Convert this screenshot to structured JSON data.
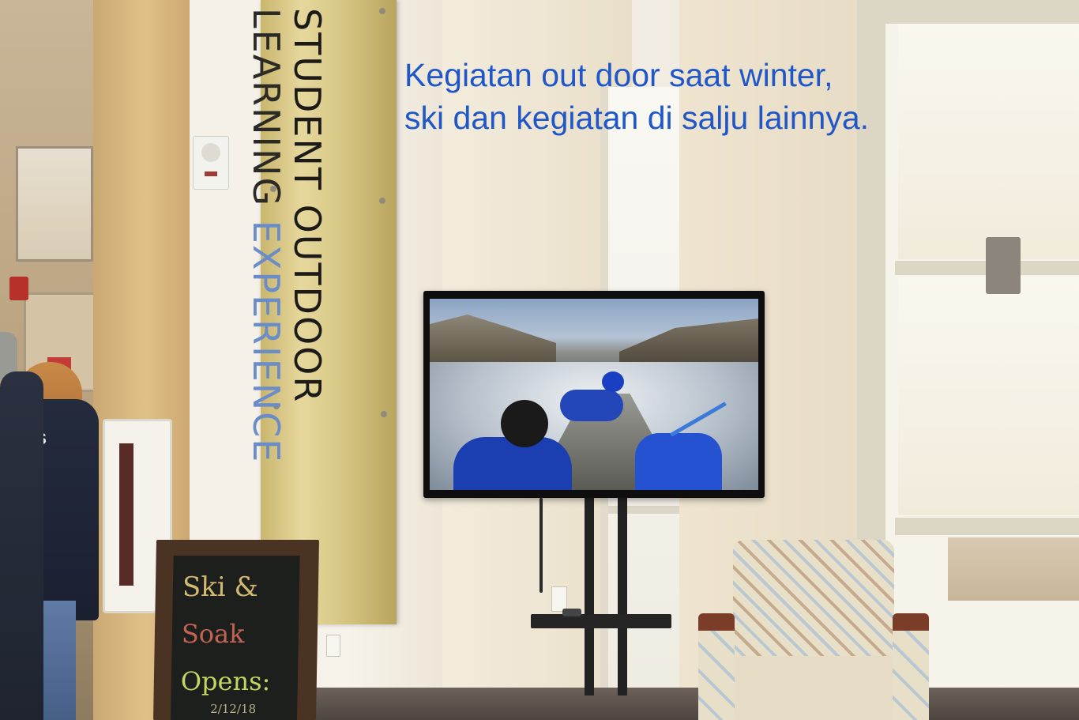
{
  "caption": {
    "line1": "Kegiatan out door saat winter,",
    "line2": "ski dan kegiatan di salju lainnya.",
    "color": "#1f57c9"
  },
  "sign": {
    "line1": "STUDENT OUTDOOR",
    "line2_part1": "LEARNING ",
    "line2_part2": "EXPERIENCE"
  },
  "chalkboard": {
    "line1": "Ski &",
    "line2": "Soak",
    "line3": "Opens:",
    "line4": "2/12/18"
  },
  "person_jacket_text": "IS"
}
